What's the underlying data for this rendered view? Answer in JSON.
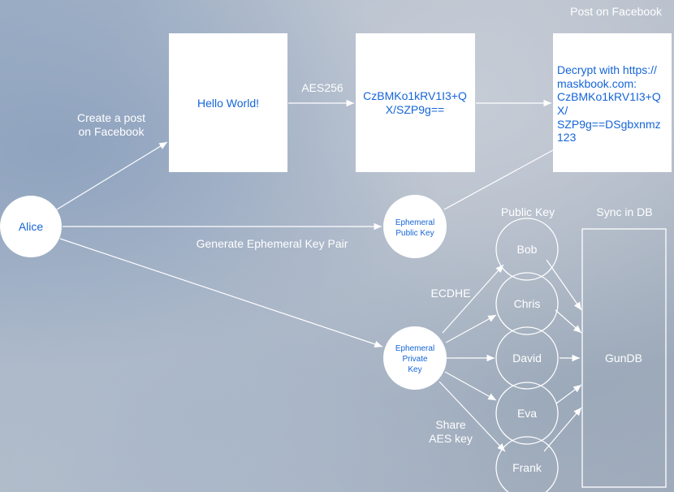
{
  "header": {
    "title": "Post on Facebook"
  },
  "nodes": {
    "alice": "Alice",
    "hello": "Hello World!",
    "cipher": [
      "CzBMKo1kRV1I3+Q",
      "X/SZP9g=="
    ],
    "decrypt": [
      "Decrypt with https://",
      "maskbook.com:",
      "CzBMKo1kRV1I3+Q",
      "X/",
      "SZP9g==DSgbxnmz",
      "123"
    ],
    "eph_public": [
      "Ephemeral",
      "Public Key"
    ],
    "eph_private": [
      "Ephemeral",
      "Private",
      "Key"
    ],
    "bob": "Bob",
    "chris": "Chris",
    "david": "David",
    "eva": "Eva",
    "frank": "Frank",
    "gundb": "GunDB"
  },
  "labels": {
    "create_post": [
      "Create a post",
      "on Facebook"
    ],
    "aes256": "AES256",
    "generate_pair": "Generate Ephemeral Key Pair",
    "public_key": "Public Key",
    "sync_db": "Sync in DB",
    "ecdhe": "ECDHE",
    "share_aes": [
      "Share",
      "AES key"
    ]
  }
}
